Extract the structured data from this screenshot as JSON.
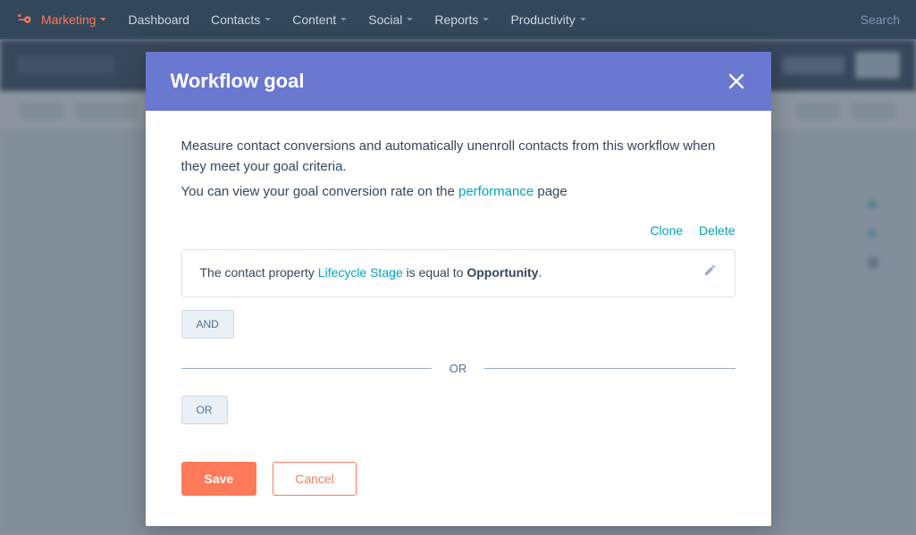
{
  "nav": {
    "primary": "Marketing",
    "items": [
      "Dashboard",
      "Contacts",
      "Content",
      "Social",
      "Reports",
      "Productivity"
    ],
    "search_placeholder": "Search"
  },
  "modal": {
    "title": "Workflow goal",
    "intro_line1": "Measure contact conversions and automatically unenroll contacts from this workflow when they meet your goal criteria.",
    "intro_line2_pre": "You can view your goal conversion rate on the ",
    "intro_link": "performance",
    "intro_line2_post": " page",
    "actions": {
      "clone": "Clone",
      "delete": "Delete"
    },
    "criteria": {
      "pre": "The contact property ",
      "property": "Lifecycle Stage",
      "mid": " is equal to ",
      "value": "Opportunity",
      "post": "."
    },
    "logic": {
      "and": "AND",
      "or_divider": "OR",
      "or_button": "OR"
    },
    "buttons": {
      "save": "Save",
      "cancel": "Cancel"
    }
  }
}
